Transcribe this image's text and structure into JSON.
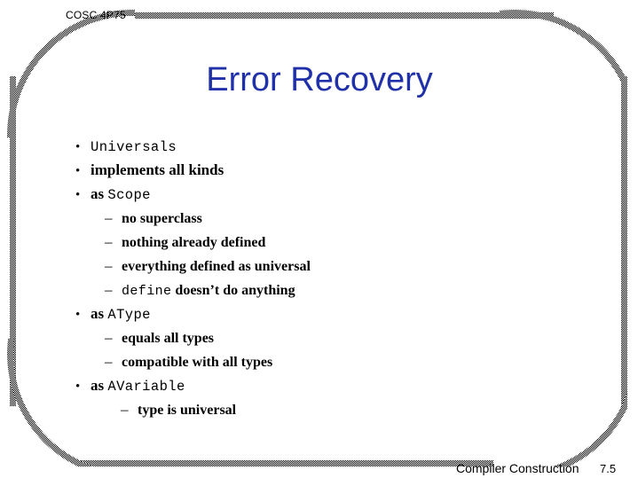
{
  "header": {
    "course_label": "COSC 4P75"
  },
  "title": {
    "text": "Error Recovery",
    "color": "#2030A8"
  },
  "bullet_markers": {
    "level1": "•",
    "level2": "–"
  },
  "outline": [
    {
      "level": 1,
      "marker": "•",
      "parts": [
        {
          "text": "Universals",
          "style": "mono"
        }
      ]
    },
    {
      "level": 1,
      "marker": "•",
      "parts": [
        {
          "text": "implements all kinds",
          "style": "serif-bold"
        }
      ]
    },
    {
      "level": 1,
      "marker": "•",
      "parts": [
        {
          "text": "as ",
          "style": "serif-bold"
        },
        {
          "text": "Scope",
          "style": "mono"
        }
      ]
    },
    {
      "level": 2,
      "marker": "–",
      "parts": [
        {
          "text": "no superclass",
          "style": "serif-bold"
        }
      ]
    },
    {
      "level": 2,
      "marker": "–",
      "parts": [
        {
          "text": "nothing already defined",
          "style": "serif-bold"
        }
      ]
    },
    {
      "level": 2,
      "marker": "–",
      "parts": [
        {
          "text": "everything defined as universal",
          "style": "serif-bold"
        }
      ]
    },
    {
      "level": 2,
      "marker": "–",
      "parts": [
        {
          "text": "define",
          "style": "mono"
        },
        {
          "text": " doesn’t do anything",
          "style": "serif-bold"
        }
      ]
    },
    {
      "level": 1,
      "marker": "•",
      "parts": [
        {
          "text": "as ",
          "style": "serif-bold"
        },
        {
          "text": "AType",
          "style": "mono"
        }
      ]
    },
    {
      "level": 2,
      "marker": "–",
      "parts": [
        {
          "text": "equals all types",
          "style": "serif-bold"
        }
      ]
    },
    {
      "level": 2,
      "marker": "–",
      "parts": [
        {
          "text": "compatible with all types",
          "style": "serif-bold"
        }
      ]
    },
    {
      "level": 1,
      "marker": "•",
      "parts": [
        {
          "text": "as ",
          "style": "serif-bold"
        },
        {
          "text": "AVariable",
          "style": "mono"
        }
      ]
    },
    {
      "level": 2,
      "deep": true,
      "marker": "–",
      "parts": [
        {
          "text": "type is universal",
          "style": "serif-bold"
        }
      ]
    }
  ],
  "footer": {
    "text": "Compiler Construction",
    "page_number": "7.5"
  }
}
